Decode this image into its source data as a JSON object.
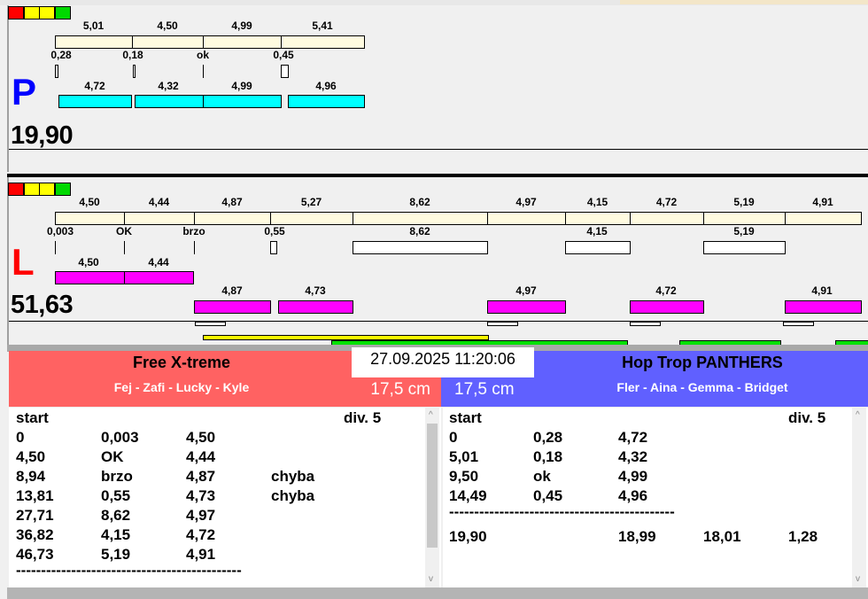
{
  "colors": {
    "red": "#ff0000",
    "yellow": "#ffff00",
    "green": "#00d800",
    "cream": "#fffbe0",
    "cyan": "#00ffff",
    "magenta": "#ff00ff",
    "team_left": "#ff6262",
    "team_right": "#6060ff"
  },
  "top_panel": {
    "letter": "P",
    "total": "19,90",
    "bar_labels": [
      "5,01",
      "4,50",
      "4,99",
      "5,41"
    ],
    "sub_labels": [
      "0,28",
      "0,18",
      "ok",
      "0,45"
    ],
    "cyan_labels": [
      "4,72",
      "4,32",
      "4,99",
      "4,96"
    ]
  },
  "bottom_panel": {
    "letter": "L",
    "total": "51,63",
    "bar_labels": [
      "4,50",
      "4,44",
      "4,87",
      "5,27",
      "8,62",
      "4,97",
      "4,15",
      "4,72",
      "5,19",
      "4,91"
    ],
    "sub_labels": [
      "0,003",
      "OK",
      "brzo",
      "0,55",
      "8,62",
      "4,15",
      "5,19"
    ],
    "magenta_row1_labels": [
      "4,50",
      "4,44"
    ],
    "magenta_row2_labels": [
      "4,87",
      "4,73",
      "4,97",
      "4,72",
      "4,91"
    ]
  },
  "datetime": "27.09.2025 11:20:06",
  "left_team": {
    "name": "Free X-treme",
    "members": "Fej - Zafi - Lucky - Kyle",
    "height": "17,5 cm",
    "header": [
      "start",
      "div. 5"
    ],
    "rows": [
      [
        "0",
        "0,003",
        "4,50",
        ""
      ],
      [
        "4,50",
        "OK",
        "4,44",
        ""
      ],
      [
        "8,94",
        "brzo",
        "4,87",
        "chyba"
      ],
      [
        "13,81",
        "0,55",
        "4,73",
        "chyba"
      ],
      [
        "27,71",
        "8,62",
        "4,97",
        ""
      ],
      [
        "36,82",
        "4,15",
        "4,72",
        ""
      ],
      [
        "46,73",
        "5,19",
        "4,91",
        ""
      ]
    ],
    "separator": "---------------------------------------------"
  },
  "right_team": {
    "name": "Hop Trop PANTHERS",
    "members": "Fler - Aina - Gemma - Bridget",
    "height": "17,5 cm",
    "header": [
      "start",
      "div. 5"
    ],
    "rows": [
      [
        "0",
        "0,28",
        "4,72"
      ],
      [
        "5,01",
        "0,18",
        "4,32"
      ],
      [
        "9,50",
        "ok",
        "4,99"
      ],
      [
        "14,49",
        "0,45",
        "4,96"
      ]
    ],
    "separator": "---------------------------------------------",
    "summary": [
      "19,90",
      "18,99",
      "18,01",
      "1,28"
    ]
  }
}
